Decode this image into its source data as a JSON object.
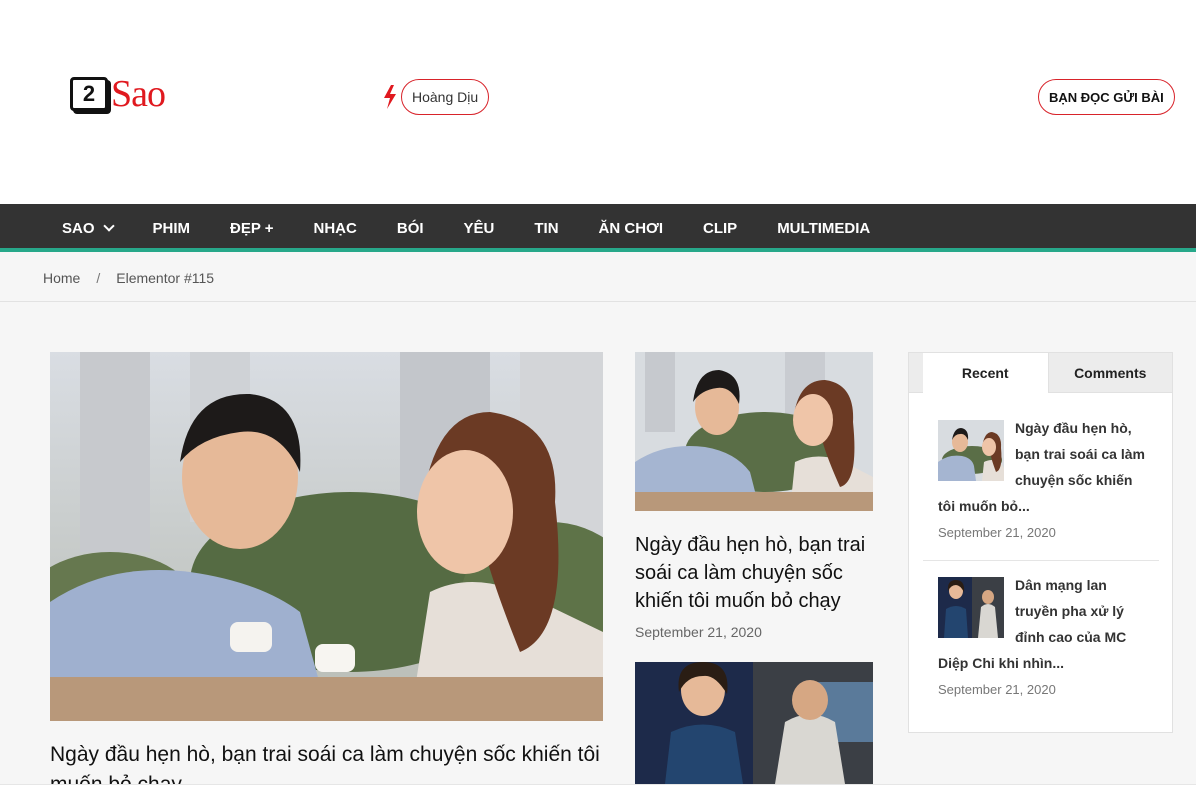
{
  "header": {
    "logo_number": "2",
    "logo_text": "Sao",
    "trending_tag": "Hoàng Dịu",
    "submit_button": "BẠN ĐỌC GỬI BÀI",
    "accent_color": "#d8232a"
  },
  "nav": {
    "items": [
      "SAO",
      "PHIM",
      "ĐẸP +",
      "NHẠC",
      "BÓI",
      "YÊU",
      "TIN",
      "ĂN CHƠI",
      "CLIP",
      "MULTIMEDIA"
    ],
    "bar_color": "#333333",
    "underline_color": "#27a88a"
  },
  "breadcrumb": {
    "home": "Home",
    "separator": "/",
    "current": "Elementor #115"
  },
  "featured": {
    "title": "Ngày đầu hẹn hò, bạn trai soái ca làm chuyện sốc khiến tôi muốn bỏ chạy"
  },
  "secondary": {
    "title": "Ngày đầu hẹn hò, bạn trai soái ca làm chuyện sốc khiến tôi muốn bỏ chạy",
    "date": "September 21, 2020"
  },
  "sidebar": {
    "tabs": [
      "Recent",
      "Comments"
    ],
    "posts": [
      {
        "title_line1": "Ngày đầu hẹn hò,",
        "title_line2": "bạn trai soái ca làm",
        "title_line3": "chuyện sốc khiến",
        "title_line4": "tôi muốn bỏ...",
        "date": "September 21, 2020"
      },
      {
        "title_line1": "Dân mạng lan",
        "title_line2": "truyền pha xử lý",
        "title_line3": "đỉnh cao của MC",
        "title_line4": "Diệp Chi khi nhìn...",
        "date": "September 21, 2020"
      }
    ]
  }
}
